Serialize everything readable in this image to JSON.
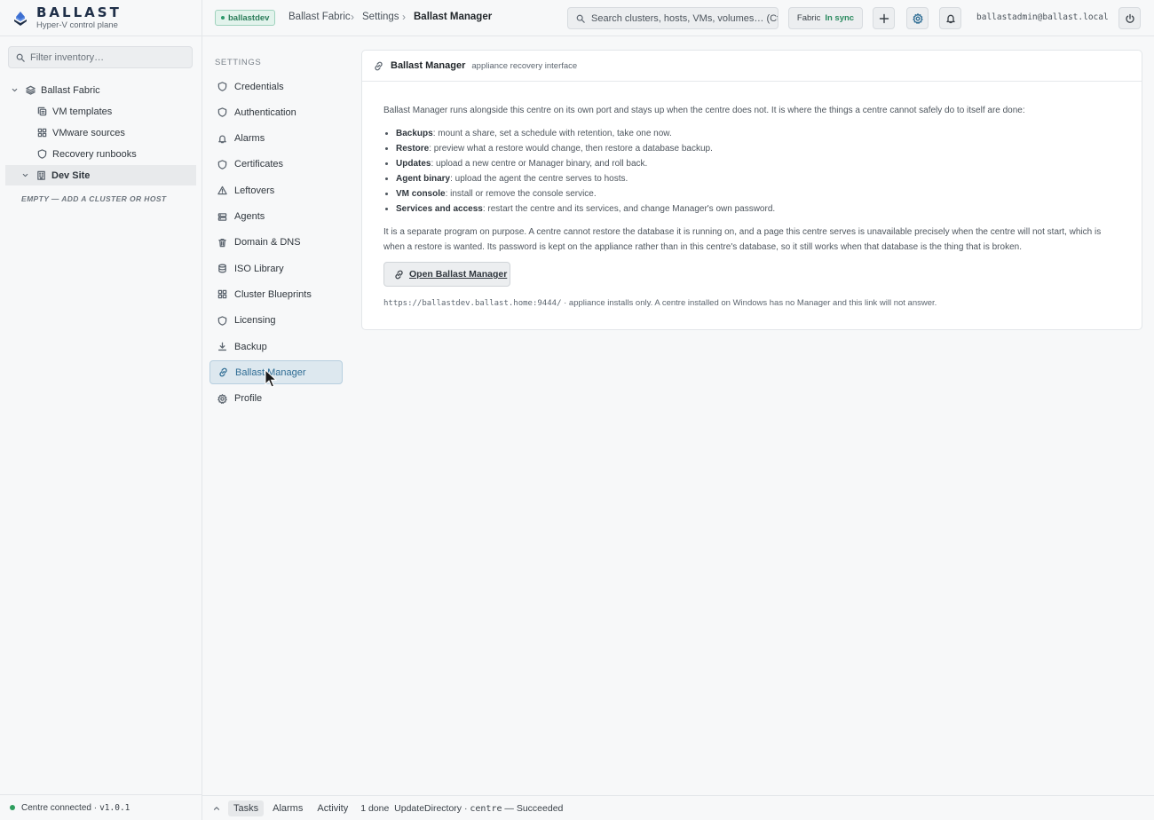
{
  "brand": {
    "name": "BALLAST",
    "tagline": "Hyper-V control plane"
  },
  "sidebar": {
    "filter_placeholder": "Filter inventory…",
    "tree": [
      {
        "label": "Ballast Fabric",
        "icon": "layers-icon"
      },
      {
        "label": "VM templates",
        "icon": "copy-icon"
      },
      {
        "label": "VMware sources",
        "icon": "grid-icon"
      },
      {
        "label": "Recovery runbooks",
        "icon": "shield-icon"
      },
      {
        "label": "Dev Site",
        "icon": "building-icon"
      }
    ],
    "empty_note": "EMPTY — ADD A CLUSTER OR HOST",
    "footer": {
      "status": "Centre connected ·",
      "version": "v1.0.1",
      "status_color": "#2e9e5e"
    }
  },
  "topbar": {
    "env_badge": "ballastdev",
    "breadcrumb": [
      "Ballast Fabric",
      "Settings",
      "Ballast Manager"
    ],
    "search_placeholder": "Search clusters, hosts, VMs, volumes… (Ctrl-K)",
    "sync_label": "Fabric",
    "sync_status": "In sync",
    "user": "ballastadmin@ballast.local"
  },
  "settings_nav": {
    "heading": "SETTINGS",
    "items": [
      {
        "label": "Credentials",
        "icon": "shield-icon"
      },
      {
        "label": "Authentication",
        "icon": "shield-icon"
      },
      {
        "label": "Alarms",
        "icon": "bell-icon"
      },
      {
        "label": "Certificates",
        "icon": "shield-icon"
      },
      {
        "label": "Leftovers",
        "icon": "warning-icon"
      },
      {
        "label": "Agents",
        "icon": "server-icon"
      },
      {
        "label": "Domain & DNS",
        "icon": "trash-icon"
      },
      {
        "label": "ISO Library",
        "icon": "database-icon"
      },
      {
        "label": "Cluster Blueprints",
        "icon": "grid-icon"
      },
      {
        "label": "Licensing",
        "icon": "shield-icon"
      },
      {
        "label": "Backup",
        "icon": "download-icon"
      },
      {
        "label": "Ballast Manager",
        "icon": "link-icon"
      },
      {
        "label": "Profile",
        "icon": "gear-icon"
      }
    ],
    "active": "Ballast Manager"
  },
  "card": {
    "title": "Ballast Manager",
    "subtitle": "appliance recovery interface",
    "intro": "Ballast Manager runs alongside this centre on its own port and stays up when the centre does not. It is where the things a centre cannot safely do to itself are done:",
    "bullets": [
      {
        "term": "Backups",
        "text": ": mount a share, set a schedule with retention, take one now."
      },
      {
        "term": "Restore",
        "text": ": preview what a restore would change, then restore a database backup."
      },
      {
        "term": "Updates",
        "text": ": upload a new centre or Manager binary, and roll back."
      },
      {
        "term": "Agent binary",
        "text": ": upload the agent the centre serves to hosts."
      },
      {
        "term": "VM console",
        "text": ": install or remove the console service."
      },
      {
        "term": "Services and access",
        "text": ": restart the centre and its services, and change Manager's own password."
      }
    ],
    "explanation": "It is a separate program on purpose. A centre cannot restore the database it is running on, and a page this centre serves is unavailable precisely when the centre will not start, which is when a restore is wanted. Its password is kept on the appliance rather than in this centre's database, so it still works when that database is the thing that is broken.",
    "button_label": "Open Ballast Manager",
    "url": "https://ballastdev.ballast.home:9444/",
    "url_note": " · appliance installs only. A centre installed on Windows has no Manager and this link will not answer."
  },
  "bottombar": {
    "tabs": [
      "Tasks",
      "Alarms",
      "Activity"
    ],
    "active_tab": "Tasks",
    "task_count": "1 done",
    "task_name": "UpdateDirectory ·",
    "task_target": "centre",
    "task_result": "— Succeeded"
  },
  "colors": {
    "accent": "#2f6d94",
    "success": "#2b8a5f",
    "brand": "#1f2f48"
  }
}
